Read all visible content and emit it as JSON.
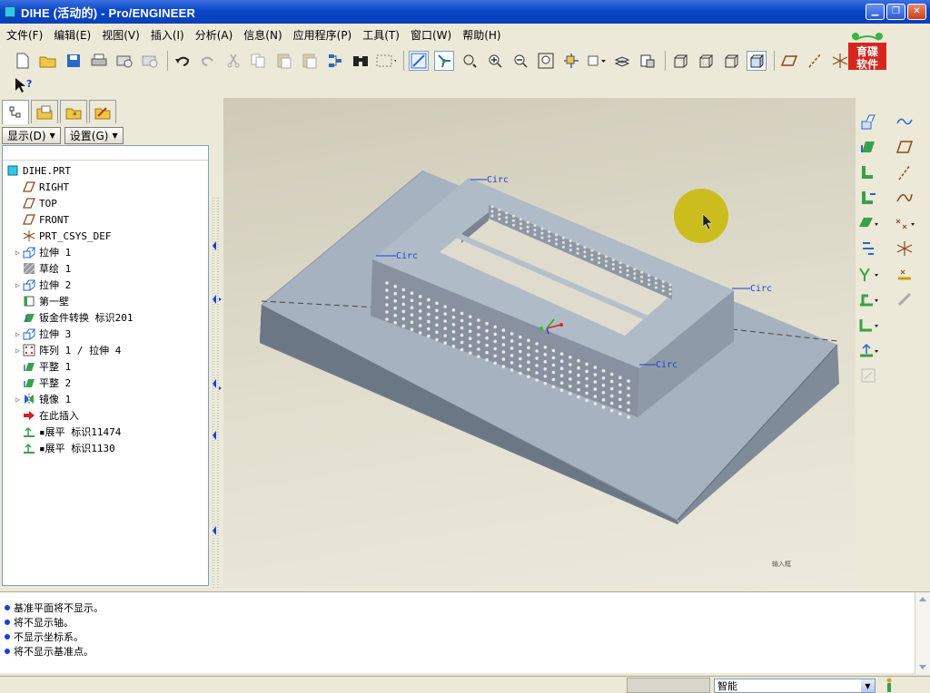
{
  "window": {
    "title": "DIHE (活动的) - Pro/ENGINEER",
    "icon": "part-icon"
  },
  "menu": [
    "文件(F)",
    "编辑(E)",
    "视图(V)",
    "插入(I)",
    "分析(A)",
    "信息(N)",
    "应用程序(P)",
    "工具(T)",
    "窗口(W)",
    "帮助(H)"
  ],
  "logo": {
    "line1": "育碟",
    "line2": "软件"
  },
  "navigator": {
    "show_label": "显示(D)",
    "settings_label": "设置(G)"
  },
  "model_tree": {
    "root": "DIHE.PRT",
    "items": [
      {
        "label": "RIGHT",
        "icon": "datum-plane-icon",
        "expandable": false
      },
      {
        "label": "TOP",
        "icon": "datum-plane-icon",
        "expandable": false
      },
      {
        "label": "FRONT",
        "icon": "datum-plane-icon",
        "expandable": false
      },
      {
        "label": "PRT_CSYS_DEF",
        "icon": "csys-icon",
        "expandable": false
      },
      {
        "label": "拉伸 1",
        "icon": "extrude-icon",
        "expandable": true
      },
      {
        "label": "草绘 1",
        "icon": "sketch-icon",
        "expandable": false
      },
      {
        "label": "拉伸 2",
        "icon": "extrude-icon",
        "expandable": true
      },
      {
        "label": "第一壁",
        "icon": "wall-icon",
        "expandable": false
      },
      {
        "label": "钣金件转换 标识201",
        "icon": "conversion-icon",
        "expandable": false
      },
      {
        "label": "拉伸 3",
        "icon": "extrude-icon",
        "expandable": true
      },
      {
        "label": "阵列 1 / 拉伸 4",
        "icon": "pattern-icon",
        "expandable": true
      },
      {
        "label": "平整 1",
        "icon": "flat-wall-icon",
        "expandable": false
      },
      {
        "label": "平整 2",
        "icon": "flat-wall-icon",
        "expandable": false
      },
      {
        "label": "镜像 1",
        "icon": "mirror-icon",
        "expandable": true
      },
      {
        "label": "在此插入",
        "icon": "insert-here-arrow-icon",
        "expandable": false
      },
      {
        "label": "▪展平 标识11474",
        "icon": "unbend-icon",
        "expandable": false
      },
      {
        "label": "▪展平 标识1130",
        "icon": "unbend-icon",
        "expandable": false
      }
    ]
  },
  "viewport": {
    "circ_labels": [
      "Circ",
      "Circ",
      "Circ",
      "Circ"
    ],
    "corner_text": "输入框"
  },
  "messages": [
    "基准平面将不显示。",
    "将不显示轴。",
    "不显示坐标系。",
    "将不显示基准点。"
  ],
  "status": {
    "filter_value": "智能"
  }
}
